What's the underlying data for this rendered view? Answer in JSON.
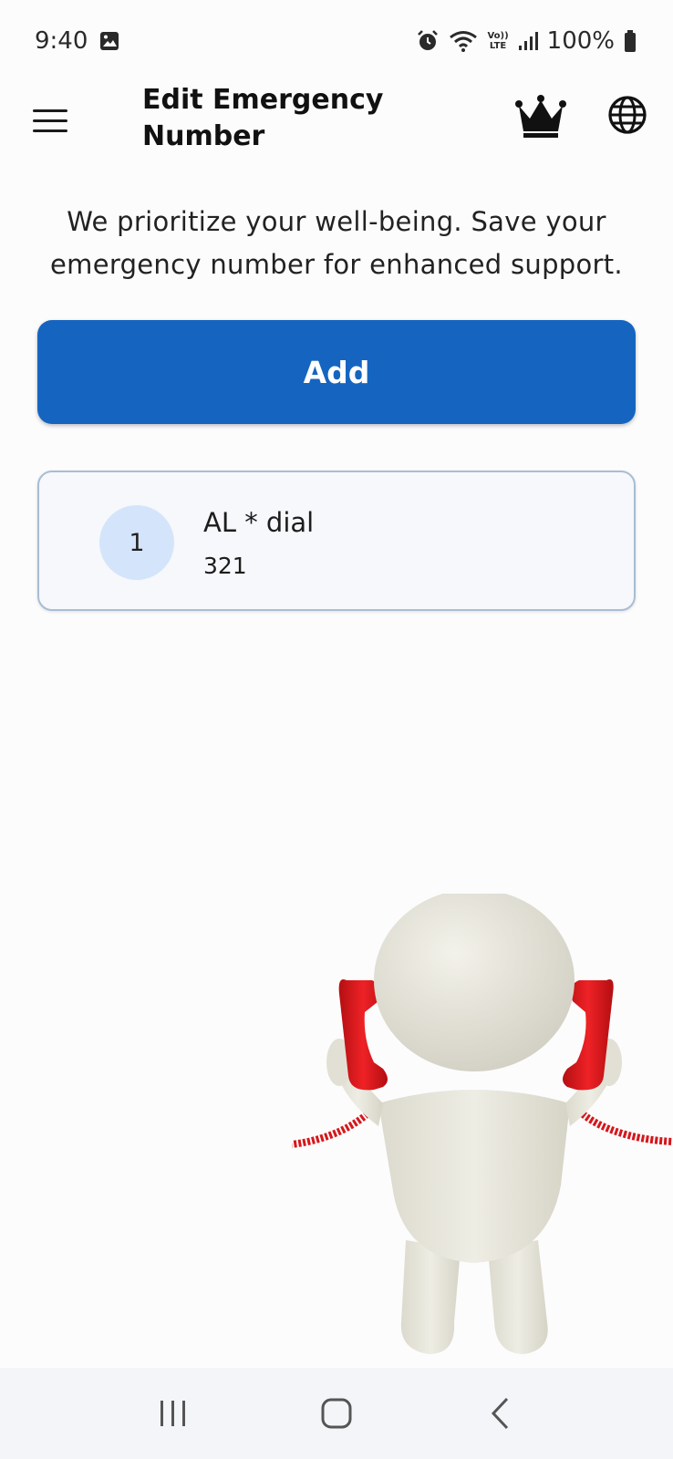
{
  "status_bar": {
    "time": "9:40",
    "battery": "100%",
    "icons": [
      "gallery-icon",
      "alarm-icon",
      "wifi-icon",
      "volte-icon",
      "signal-icon",
      "battery-icon"
    ],
    "volte_top": "Vo))",
    "volte_bottom": "LTE"
  },
  "header": {
    "title_line1": "Edit Emergency",
    "title_line2": "Number",
    "icons": [
      "menu-icon",
      "crown-icon",
      "globe-icon"
    ]
  },
  "subtitle": {
    "line1": "We prioritize your well-being. Save your",
    "line2": "emergency number for enhanced support."
  },
  "add_button": {
    "label": "Add",
    "color": "#1565c0"
  },
  "contacts": [
    {
      "index": "1",
      "name": "AL * dial",
      "number": "321"
    }
  ],
  "illustration": {
    "description_icon": "person-with-phones-illustration",
    "phone_color": "#e3191d"
  },
  "nav_bar": {
    "icons": [
      "recents-icon",
      "home-icon",
      "back-icon"
    ]
  }
}
